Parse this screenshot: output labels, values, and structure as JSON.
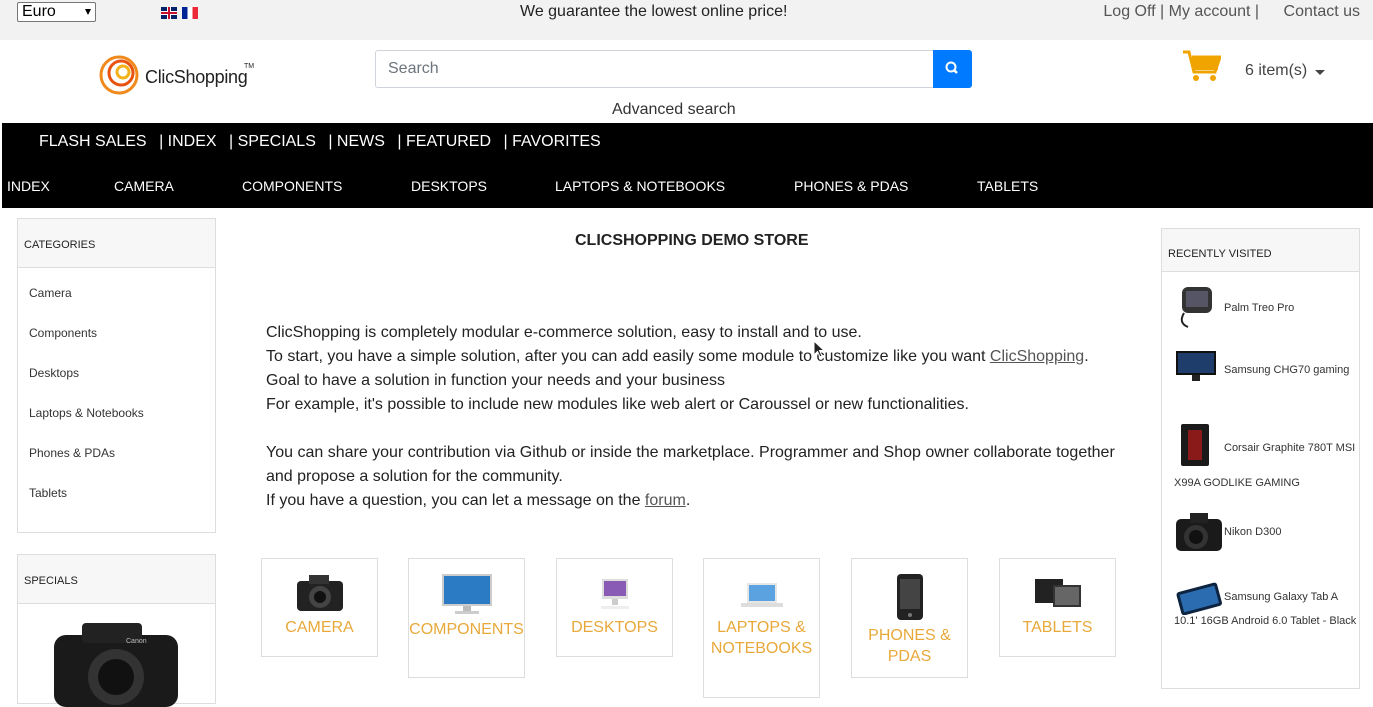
{
  "topbar": {
    "currency": "Euro",
    "guarantee": "We guarantee the lowest online price!",
    "logoff": "Log Off",
    "sep1": " | ",
    "account": "My account",
    "sep2": " |",
    "contact": "Contact us"
  },
  "header": {
    "logo_text": "ClicShopping",
    "logo_tm": "TM",
    "search_placeholder": "Search",
    "advanced_search": "Advanced search",
    "cart_count": "6 item(s)"
  },
  "nav": {
    "top": [
      "FLASH SALES",
      "| INDEX",
      "| SPECIALS",
      "| NEWS",
      "| FEATURED",
      "| FAVORITES"
    ],
    "categories": [
      "INDEX",
      "CAMERA",
      "COMPONENTS",
      "DESKTOPS",
      "LAPTOPS & NOTEBOOKS",
      "PHONES & PDAS",
      "TABLETS"
    ]
  },
  "sidebar": {
    "categories_title": "CATEGORIES",
    "categories": [
      "Camera",
      "Components",
      "Desktops",
      "Laptops & Notebooks",
      "Phones & PDAs",
      "Tablets"
    ],
    "specials_title": "SPECIALS"
  },
  "main": {
    "title": "CLICSHOPPING DEMO STORE",
    "line1": "ClicShopping is completely modular e-commerce solution, easy to install and to use.",
    "line2a": "To start, you have a simple solution, after you can add easily some module to customize like you want ",
    "line2_link": "ClicShopping",
    "line2b": ".",
    "line3": "Goal to have a solution in function your needs and your business",
    "line4": "For example, it's possible to include new modules like web alert or Caroussel or new functionalities.",
    "line5": "You can share your contribution via Github or inside the marketplace. Programmer and Shop owner collaborate together and propose a solution for the community.",
    "line6a": "If you have a question, you can let a message on the ",
    "line6_link": "forum",
    "line6b": ".",
    "tiles": [
      "CAMERA",
      "COMPONENTS",
      "DESKTOPS",
      "LAPTOPS & NOTEBOOKS",
      "PHONES & PDAS",
      "TABLETS"
    ]
  },
  "recent": {
    "title": "RECENTLY VISITED",
    "items": [
      "Palm Treo Pro",
      "Samsung CHG70 gaming",
      "Corsair Graphite 780T MSI X99A GODLIKE GAMING",
      "Nikon D300",
      "Samsung Galaxy Tab A 10.1' 16GB Android 6.0 Tablet - Black"
    ]
  },
  "colors": {
    "accent": "#007bff",
    "tile_label": "#e8a93a",
    "cart": "#f0a400"
  }
}
